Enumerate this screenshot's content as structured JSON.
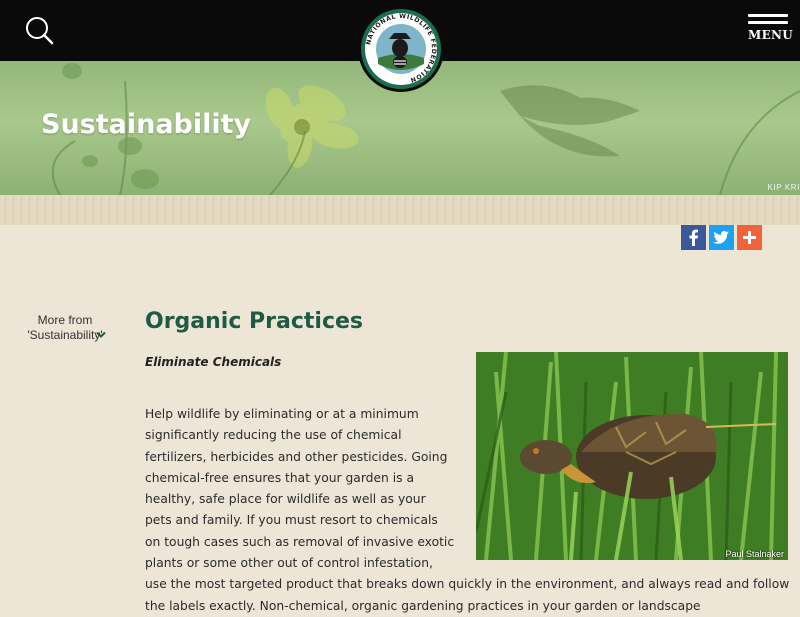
{
  "header": {
    "menu_label": "MENU",
    "logo_text": "NATIONAL WILDLIFE FEDERATION"
  },
  "hero": {
    "title": "Sustainability",
    "credit": "KIP KRI"
  },
  "share": {
    "icons": [
      "facebook-icon",
      "twitter-icon",
      "plus-icon"
    ]
  },
  "sidebar": {
    "more_from_line1": "More from",
    "more_from_line2": "'Sustainability'"
  },
  "article": {
    "title": "Organic Practices",
    "subhead": "Eliminate Chemicals",
    "photo_credit": "Paul Stalnaker",
    "body": "Help wildlife by eliminating or at a minimum significantly reducing the use of chemical fertilizers, herbicides and other pesticides. Going chemical-free ensures that your garden is a healthy, safe place for wildlife as well as your pets and family. If you must resort to chemicals on tough cases such as removal of invasive exotic plants or some other out of control infestation, use the most targeted product that breaks down quickly in the environment, and always read and follow the labels exactly. Non-chemical, organic gardening practices in your garden or landscape"
  },
  "colors": {
    "topbar": "#0a0a0a",
    "title_green": "#1f5a42",
    "facebook": "#3b5998",
    "twitter": "#1da1f2",
    "addthis": "#f1643a",
    "page_bg": "#ede6d6"
  }
}
